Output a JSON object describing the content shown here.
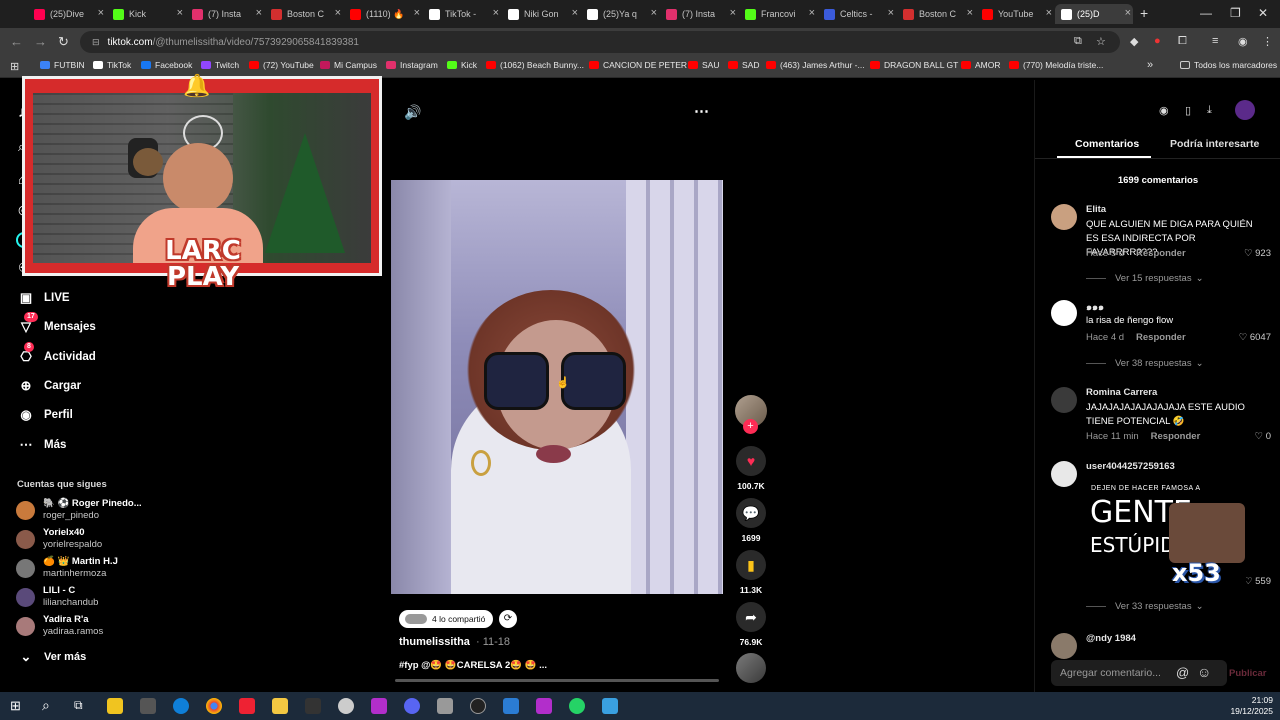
{
  "browser": {
    "tabs": [
      {
        "label": "(25)Dive",
        "color": "#ff0050"
      },
      {
        "label": "Kick",
        "color": "#53fc18"
      },
      {
        "label": "(7) Insta",
        "color": "#e1306c"
      },
      {
        "label": "Boston C",
        "color": "#d32f2f"
      },
      {
        "label": "(1110) 🔥",
        "color": "#ff0000"
      },
      {
        "label": "TikTok -",
        "color": "#ffffff"
      },
      {
        "label": "Niki Gon",
        "color": "#ffffff"
      },
      {
        "label": "(25)Ya q",
        "color": "#ffffff"
      },
      {
        "label": "(7) Insta",
        "color": "#e1306c"
      },
      {
        "label": "Francovi",
        "color": "#53fc18"
      },
      {
        "label": "Celtics -",
        "color": "#3b5bdb"
      },
      {
        "label": "Boston C",
        "color": "#d32f2f"
      },
      {
        "label": "YouTube",
        "color": "#ff0000"
      },
      {
        "label": "(25)D",
        "color": "#ffffff"
      }
    ],
    "url_domain": "tiktok.com",
    "url_path": "/@thumelissitha/video/7573929065841839381",
    "bookmarks": [
      {
        "label": "FUTBIN",
        "color": "#3b82f6"
      },
      {
        "label": "TikTok",
        "color": "#ffffff"
      },
      {
        "label": "Facebook",
        "color": "#1877f2"
      },
      {
        "label": "Twitch",
        "color": "#9146ff"
      },
      {
        "label": "(72) YouTube",
        "color": "#ff0000"
      },
      {
        "label": "Mi Campus",
        "color": "#c2185b"
      },
      {
        "label": "Instagram",
        "color": "#e1306c"
      },
      {
        "label": "Kick",
        "color": "#53fc18"
      },
      {
        "label": "(1062) Beach Bunny...",
        "color": "#ff0000"
      },
      {
        "label": "CANCION DE PETER",
        "color": "#ff0000"
      },
      {
        "label": "SAU",
        "color": "#ff0000"
      },
      {
        "label": "SAD",
        "color": "#ff0000"
      },
      {
        "label": "(463) James Arthur -...",
        "color": "#ff0000"
      },
      {
        "label": "DRAGON BALL GT",
        "color": "#ff0000"
      },
      {
        "label": "AMOR",
        "color": "#ff0000"
      },
      {
        "label": "(770) Melodía triste...",
        "color": "#ff0000"
      }
    ],
    "all_bookmarks": "Todos los marcadores"
  },
  "sidebar": {
    "nav": [
      {
        "label": "LIVE",
        "icon": "live-icon"
      },
      {
        "label": "Mensajes",
        "icon": "messages-icon",
        "badge": "17"
      },
      {
        "label": "Actividad",
        "icon": "activity-icon",
        "badge": "8"
      },
      {
        "label": "Cargar",
        "icon": "upload-icon"
      },
      {
        "label": "Perfil",
        "icon": "profile-icon"
      },
      {
        "label": "Más",
        "icon": "more-icon"
      }
    ],
    "following_title": "Cuentas que sigues",
    "following": [
      {
        "name": "🐘 ⚽ Roger Pinedo...",
        "handle": "roger_pinedo",
        "color": "#c97a3c"
      },
      {
        "name": "Yorielx40",
        "handle": "yorielrespaldo",
        "color": "#8a5a4a"
      },
      {
        "name": "🍊 👑 Martin H.J",
        "handle": "martinhermoza",
        "color": "#777777"
      },
      {
        "name": "LILI - C",
        "handle": "lilianchandub",
        "color": "#5a4a7a"
      },
      {
        "name": "Yadira R'a",
        "handle": "yadiraa.ramos",
        "color": "#a87a7a"
      }
    ],
    "see_more": "Ver más"
  },
  "overlay": {
    "logo_line1": "LARC",
    "logo_line2": "PLAY"
  },
  "video": {
    "shared_label": "4 lo compartió",
    "author": "thumelissitha",
    "date": "· 11-18",
    "caption": "#fyp @🤩 🤩CARELSA 2🤩 🤩 ...",
    "likes": "100.7K",
    "comments": "1699",
    "saves": "11.3K",
    "shares": "76.9K"
  },
  "comments_panel": {
    "tab_comments": "Comentarios",
    "tab_interest": "Podría interesarte",
    "count_label": "1699 comentarios",
    "reply_label": "Responder",
    "items": [
      {
        "user": "Elita",
        "text": "QUE ALGUIEN ME DIGA PARA QUIÉN ES ESA INDIRECTA POR FAVARRRR????",
        "time": "Hace 5 d",
        "likes": "923",
        "more": "Ver 15 respuestas"
      },
      {
        "user": "๑๑๑",
        "text": "la risa de ñengo flow",
        "time": "Hace 4 d",
        "likes": "6047",
        "more": "Ver 38 respuestas"
      },
      {
        "user": "Romina Carrera",
        "text": "JAJAJAJAJAJAJAJAJA ESTE AUDIO TIENE POTENCIAL 🤣",
        "time": "Hace 11 min",
        "likes": "0",
        "more": ""
      },
      {
        "user": "user4044257259163",
        "text": "",
        "time": "Hace 4 d",
        "likes": "559",
        "more": "Ver 33 respuestas"
      },
      {
        "user": "@ndy 1984",
        "text": "",
        "time": "",
        "likes": "",
        "more": ""
      }
    ],
    "meme_top": "DEJEN DE HACER FAMOSA A",
    "meme_big1": "GENTE",
    "meme_big2": "ESTÚPIDA",
    "meme_badge": "x53",
    "input_placeholder": "Agregar comentario...",
    "publish": "Publicar"
  },
  "taskbar": {
    "time": "21:09",
    "date": "19/12/2025"
  }
}
